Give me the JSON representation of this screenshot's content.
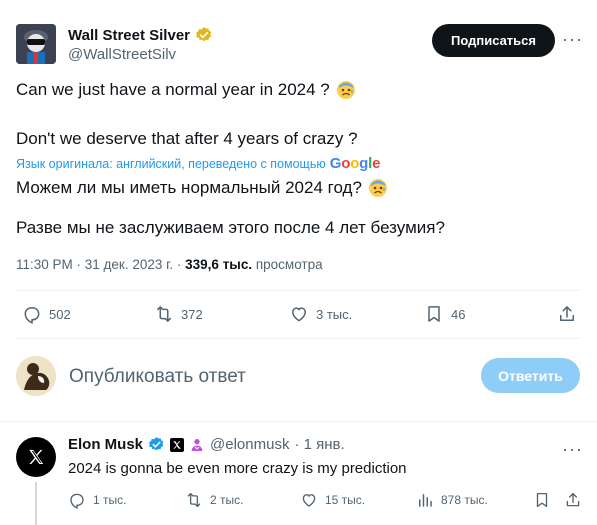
{
  "tweet": {
    "author_name": "Wall Street Silver",
    "author_handle": "@WallStreetSilv",
    "follow_label": "Подписаться",
    "line1": "Can we just have a normal year in 2024 ?",
    "line2": "Don't we deserve that after 4 years of crazy ?",
    "translated_prefix": "Язык оригинала: английский, переведено с помощью",
    "translated_brand": "Google",
    "translation1": "Можем ли мы иметь нормальный 2024 год?",
    "translation2": "Разве мы не заслуживаем этого после 4 лет безумия?",
    "time": "11:30 PM · 31 дек. 2023 г. · ",
    "views_count": "339,6 тыс.",
    "views_label": " просмотра",
    "stats": {
      "replies": "502",
      "reposts": "372",
      "likes": "3 тыс.",
      "bookmarks": "46"
    }
  },
  "reply_box": {
    "placeholder": "Опубликовать ответ",
    "button_label": "Ответить"
  },
  "reply": {
    "author_name": "Elon Musk",
    "author_handle": "@elonmusk",
    "date": "· 1 янв.",
    "text": "2024 is gonna be even more crazy is my prediction",
    "stats": {
      "replies": "1 тыс.",
      "reposts": "2 тыс.",
      "likes": "15 тыс.",
      "views": "878 тыс."
    }
  },
  "colors": {
    "accent": "#1d9bf0",
    "verified_gold": "#e2b719",
    "verified_blue": "#1d9bf0",
    "muted_text": "#536471",
    "follow_button": "#0f1419",
    "reply_button_disabled": "#8ecdf8"
  },
  "icons": [
    "verified-gold-icon",
    "more-icon",
    "anxious-emoji-icon",
    "reply-icon",
    "repost-icon",
    "like-icon",
    "bookmark-icon",
    "share-icon",
    "x-logo-icon",
    "verified-blue-icon",
    "x-affiliate-icon",
    "person-badge-icon",
    "views-icon"
  ]
}
